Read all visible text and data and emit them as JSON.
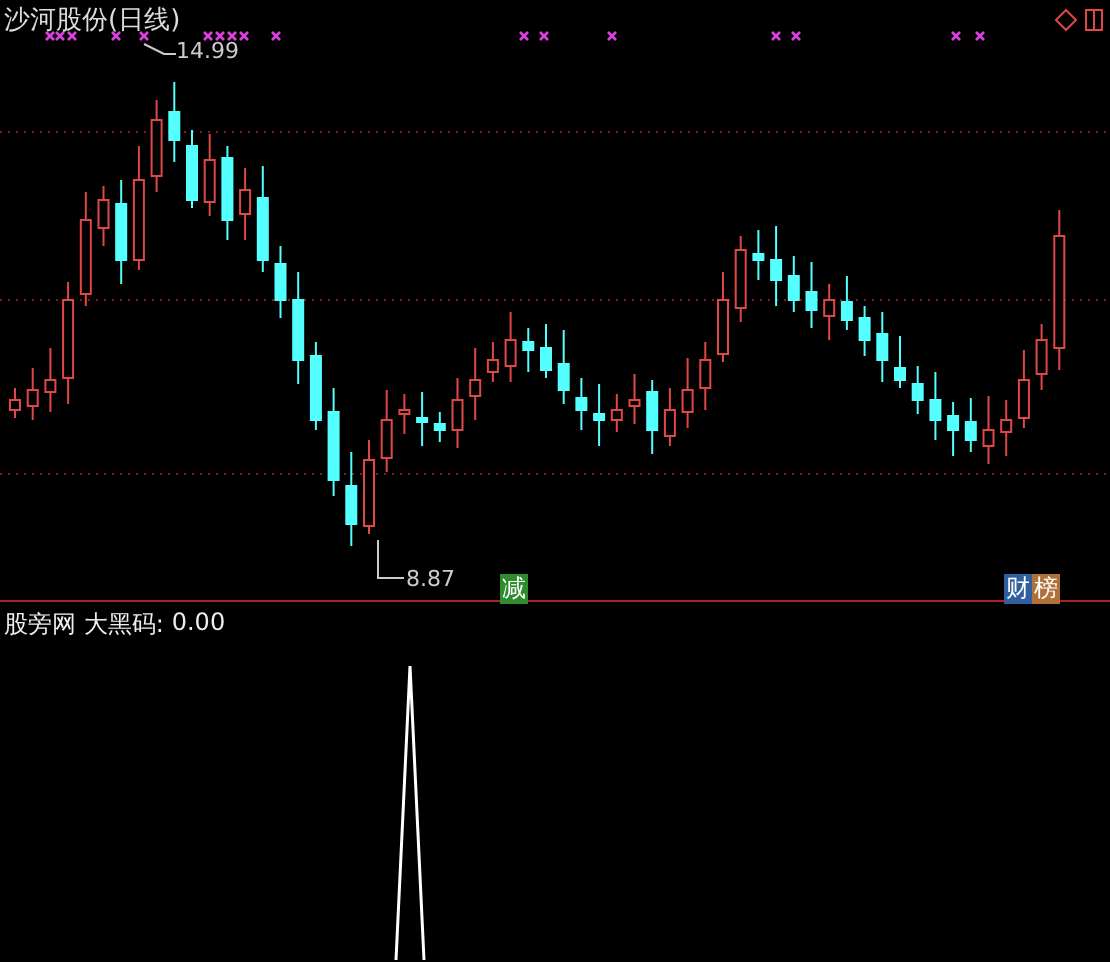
{
  "main_panel": {
    "title": "沙河股份(日线)",
    "high_label": "14.99",
    "low_label": "8.87",
    "badges": [
      {
        "text": "减",
        "color": "#2e8b2e"
      },
      {
        "text": "财",
        "color": "#2f5f9e"
      },
      {
        "text": "榜",
        "color": "#b0703a"
      }
    ]
  },
  "indicator_panel": {
    "title": "股旁网 大黑码:",
    "value": "0.00"
  }
}
